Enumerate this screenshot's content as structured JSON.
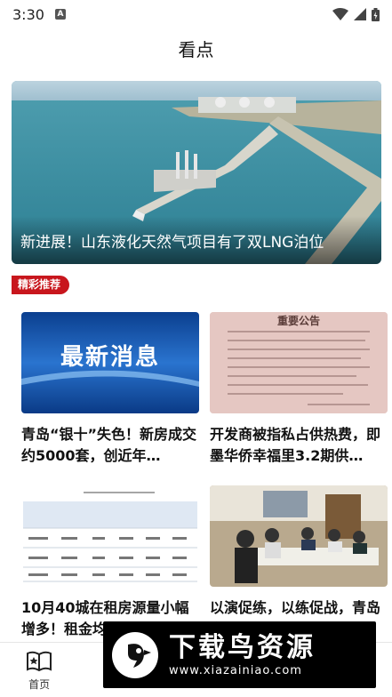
{
  "status_bar": {
    "time": "3:30"
  },
  "header": {
    "title": "看点"
  },
  "hero": {
    "caption": "新进展！山东液化天然气项目有了双LNG泊位"
  },
  "section": {
    "tag": "精彩推荐"
  },
  "cards": [
    {
      "title": "青岛“银十”失色！新房成交约5000套，创近年…",
      "image_text": "最新消息"
    },
    {
      "title": "开发商被指私占供热费，即墨华侨幸福里3.2期供…",
      "image_text": "重要公告"
    },
    {
      "title": "10月40城在租房源量小幅增多！租金均价凸显稳态…",
      "image_text": ""
    },
    {
      "title": "以演促练，以练促战，青岛市即墨区开展重污染…",
      "image_text": ""
    }
  ],
  "tabbar": {
    "tabs": [
      {
        "label": "首页",
        "icon": "book-icon"
      },
      {
        "label": "",
        "icon": "tab-icon"
      },
      {
        "label": "",
        "icon": "tab-icon"
      },
      {
        "label": "",
        "icon": "tab-icon"
      },
      {
        "label": "",
        "icon": "tab-icon"
      }
    ]
  },
  "watermark": {
    "title": "下载鸟资源",
    "url": "www.xiazainiao.com"
  }
}
